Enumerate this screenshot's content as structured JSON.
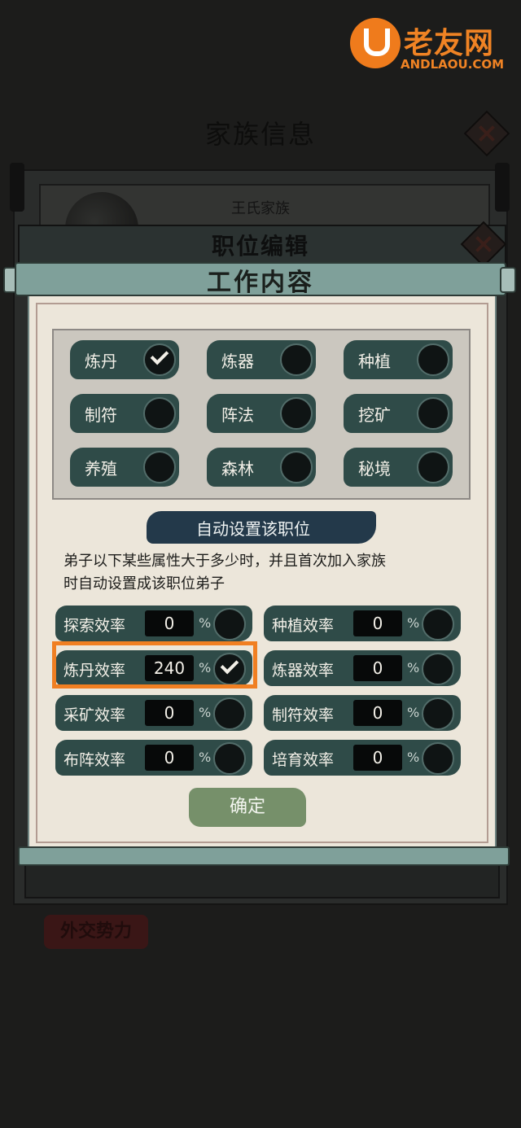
{
  "watermark": {
    "brand": "老友网",
    "domain": "ANDLAOU.COM"
  },
  "background": {
    "page_title": "家族信息",
    "family_name": "王氏家族",
    "role_edit_title": "职位编辑",
    "diplomacy_button": "外交势力"
  },
  "dialog": {
    "title": "工作内容",
    "jobs": [
      {
        "label": "炼丹",
        "checked": true
      },
      {
        "label": "炼器",
        "checked": false
      },
      {
        "label": "种植",
        "checked": false
      },
      {
        "label": "制符",
        "checked": false
      },
      {
        "label": "阵法",
        "checked": false
      },
      {
        "label": "挖矿",
        "checked": false
      },
      {
        "label": "养殖",
        "checked": false
      },
      {
        "label": "森林",
        "checked": false
      },
      {
        "label": "秘境",
        "checked": false
      }
    ],
    "auto_title": "自动设置该职位",
    "description_line1": "弟子以下某些属性大于多少时，并且首次加入家族",
    "description_line2": "时自动设置成该职位弟子",
    "efficiency": [
      {
        "label": "探索效率",
        "value": "0",
        "unit": "%",
        "checked": false
      },
      {
        "label": "种植效率",
        "value": "0",
        "unit": "%",
        "checked": false
      },
      {
        "label": "炼丹效率",
        "value": "240",
        "unit": "%",
        "checked": true
      },
      {
        "label": "炼器效率",
        "value": "0",
        "unit": "%",
        "checked": false
      },
      {
        "label": "采矿效率",
        "value": "0",
        "unit": "%",
        "checked": false
      },
      {
        "label": "制符效率",
        "value": "0",
        "unit": "%",
        "checked": false
      },
      {
        "label": "布阵效率",
        "value": "0",
        "unit": "%",
        "checked": false
      },
      {
        "label": "培育效率",
        "value": "0",
        "unit": "%",
        "checked": false
      }
    ],
    "confirm_label": "确定"
  },
  "colors": {
    "highlight": "#f07f22",
    "panel": "#2f4b48",
    "paper": "#ece6da"
  }
}
